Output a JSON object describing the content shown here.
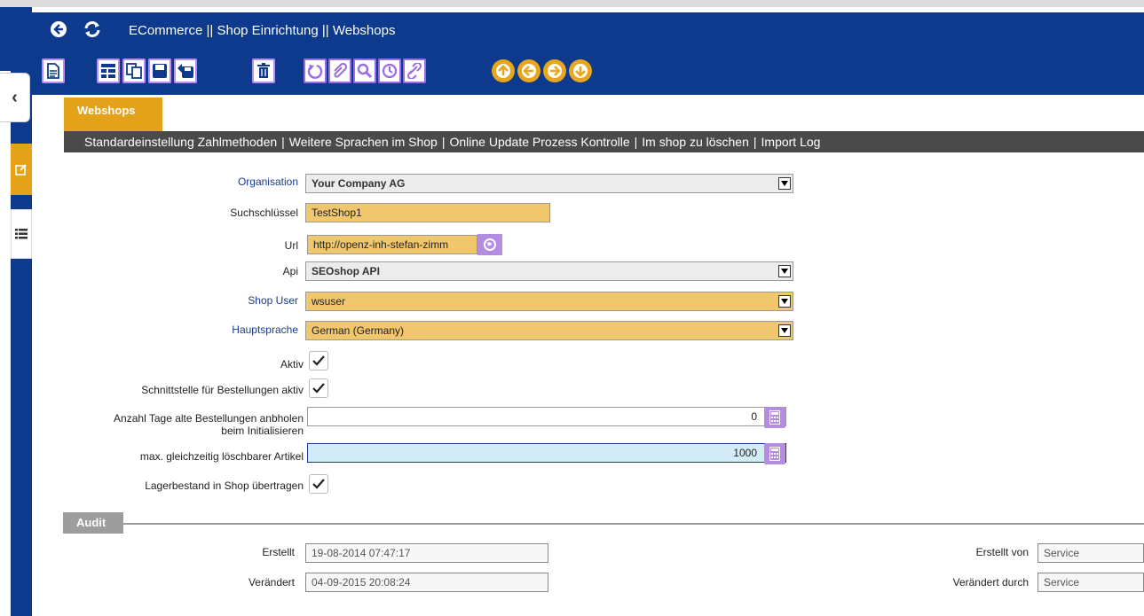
{
  "header": {
    "title": "ECommerce || Shop Einrichtung || Webshops",
    "back_icon": "back-arrow-icon",
    "refresh_icon": "refresh-icon"
  },
  "toolbar": {
    "groups": [
      [
        "new-document-icon"
      ],
      [
        "grid-edit-icon",
        "copy-icon",
        "save-icon",
        "save-new-icon"
      ],
      [
        "delete-icon"
      ],
      [
        "undo-icon",
        "attachment-icon",
        "search-icon",
        "history-icon",
        "link-icon"
      ],
      [
        "arrow-up-icon",
        "arrow-left-icon",
        "arrow-right-icon",
        "arrow-down-icon"
      ]
    ]
  },
  "tab": {
    "label": "Webshops"
  },
  "subnav": [
    "Standardeinstellung Zahlmethoden",
    "Weitere Sprachen im Shop",
    "Online Update Prozess Kontrolle",
    "Im shop zu löschen",
    "Import Log"
  ],
  "form": {
    "organisation": {
      "label": "Organisation",
      "value": "Your Company AG"
    },
    "suchschluessel": {
      "label": "Suchschlüssel",
      "value": "TestShop1"
    },
    "url": {
      "label": "Url",
      "value": "http://openz-inh-stefan-zimm"
    },
    "api": {
      "label": "Api",
      "value": "SEOshop API"
    },
    "shop_user": {
      "label": "Shop User",
      "value": "wsuser"
    },
    "hauptsprache": {
      "label": "Hauptsprache",
      "value": "German (Germany)"
    },
    "aktiv": {
      "label": "Aktiv",
      "checked": true
    },
    "schnittstelle": {
      "label": "Schnittstelle für Bestellungen aktiv",
      "checked": true
    },
    "anzahl_tage": {
      "label_line1": "Anzahl Tage alte Bestellungen anbholen",
      "label_line2": "beim Initialisieren",
      "value": "0"
    },
    "max_loeschbar": {
      "label": "max. gleichzeitig löschbarer Artikel",
      "value": "1000"
    },
    "lagerbestand": {
      "label": "Lagerbestand in Shop übertragen",
      "checked": true
    }
  },
  "audit": {
    "title": "Audit",
    "erstellt": {
      "label": "Erstellt",
      "value": "19-08-2014 07:47:17"
    },
    "veraendert": {
      "label": "Verändert",
      "value": "04-09-2015 20:08:24"
    },
    "erstellt_von": {
      "label": "Erstellt von",
      "value": "Service"
    },
    "veraendert_durch": {
      "label": "Verändert durch",
      "value": "Service"
    }
  },
  "colors": {
    "primary": "#0d3a8c",
    "accent": "#e3a21a",
    "toolbar_purple": "#9a6be6",
    "required_field": "#f1c76d",
    "subnav": "#4a4a4a"
  }
}
